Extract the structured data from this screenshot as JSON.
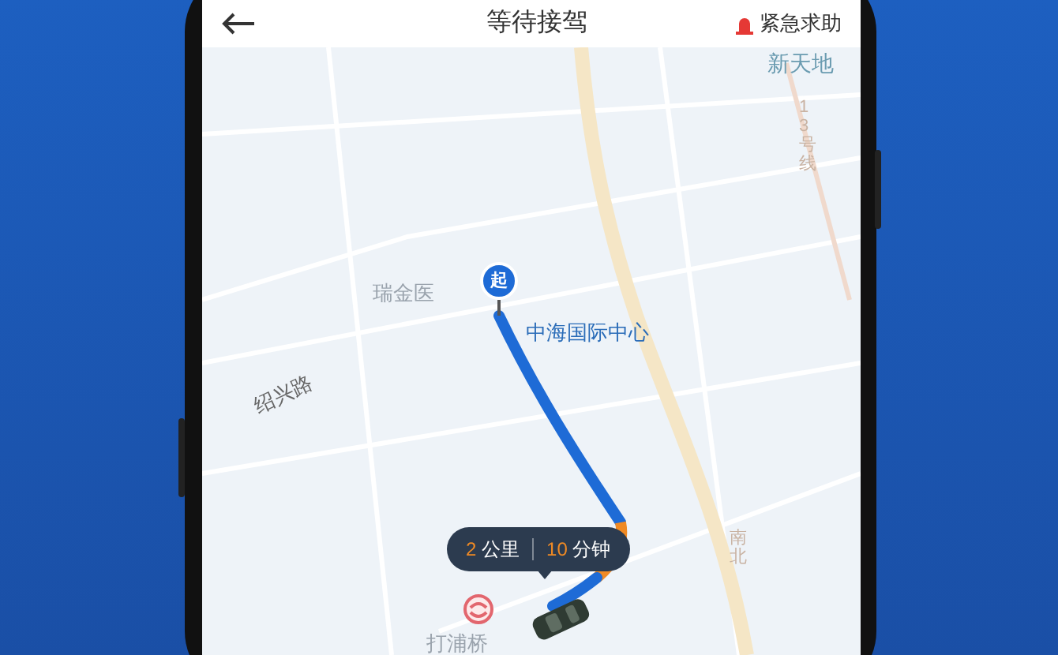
{
  "header": {
    "title": "等待接驾",
    "emergency": "紧急求助"
  },
  "map": {
    "labels": [
      {
        "kind": "district",
        "text": "新天地"
      },
      {
        "kind": "vertical",
        "text": "13号线"
      },
      {
        "kind": "poi",
        "text": "瑞金医"
      },
      {
        "kind": "poi-blue",
        "text": "中海国际中心"
      },
      {
        "kind": "road",
        "text": "绍兴路"
      },
      {
        "kind": "vertical",
        "text": "南北"
      },
      {
        "kind": "poi",
        "text": "打浦桥"
      }
    ],
    "start_marker": "起",
    "trip": {
      "distance": "2",
      "distance_unit": "公里",
      "time": "10",
      "time_unit": "分钟"
    }
  }
}
